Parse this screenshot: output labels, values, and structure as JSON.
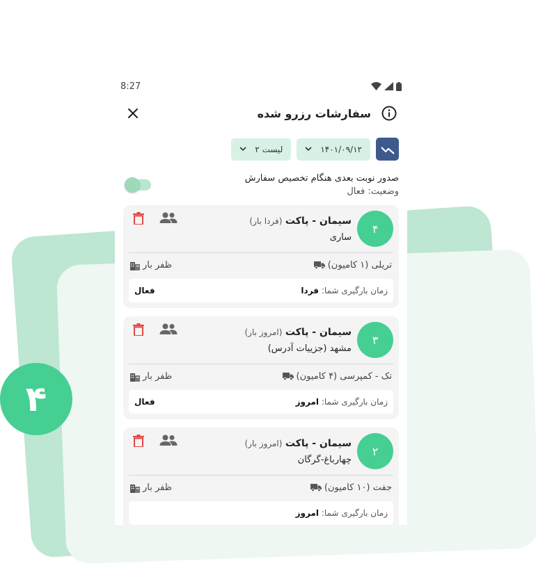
{
  "status_bar": {
    "time": "8:27"
  },
  "app_bar": {
    "title": "سفارشات رزرو شده"
  },
  "filters": {
    "date": "۱۴۰۱/۰۹/۱۲",
    "list": "لیست ۲"
  },
  "toggle_section": {
    "title": "صدور نوبت بعدی هنگام تخصیص سفارش",
    "status": "وضعیت: فعال",
    "enabled": true
  },
  "badge": {
    "number": "۴"
  },
  "colors": {
    "accent": "#45cf92",
    "light_accent": "#d8f1e5",
    "chart_button": "#3e5a8c",
    "delete": "#e54848"
  },
  "cards": [
    {
      "number": "۴",
      "title": "سیمان - پاکت",
      "subtitle": "(فردا بار)",
      "location": "ساری",
      "vehicle": "تریلی (۱ کامیون)",
      "container": "ظفر بار",
      "loading_label": "زمان بارگیری شما:",
      "loading_value": "فردا",
      "state": "فعال"
    },
    {
      "number": "۳",
      "title": "سیمان - پاکت",
      "subtitle": "(امروز بار)",
      "location": "مشهد (جزییات آدرس)",
      "vehicle": "تک - کمپرسی (۴ کامیون)",
      "container": "ظفر بار",
      "loading_label": "زمان بارگیری شما:",
      "loading_value": "امروز",
      "state": "فعال"
    },
    {
      "number": "۲",
      "title": "سیمان - پاکت",
      "subtitle": "(امروز بار)",
      "location": "چهارباغ-گرگان",
      "vehicle": "جفت (۱۰ کامیون)",
      "container": "ظفر بار",
      "loading_label": "زمان بارگیری شما:",
      "loading_value": "امروز",
      "state": ""
    }
  ],
  "icons": [
    "close-icon",
    "info-icon",
    "chart-icon",
    "chevron-down-icon",
    "delete-icon",
    "group-icon",
    "truck-icon",
    "building-icon",
    "wifi-icon",
    "signal-icon",
    "battery-icon"
  ]
}
